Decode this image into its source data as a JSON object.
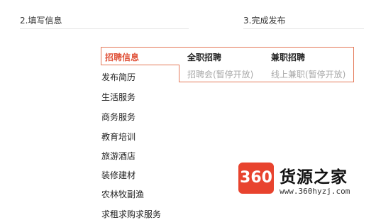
{
  "steps": {
    "step2": "2.填写信息",
    "step3": "3.完成发布"
  },
  "categories": [
    "招聘信息",
    "发布简历",
    "生活服务",
    "商务服务",
    "教育培训",
    "旅游酒店",
    "装修建材",
    "农林牧副渔",
    "求租求购求服务"
  ],
  "submenu": {
    "full_time": "全职招聘",
    "part_time": "兼职招聘",
    "job_fair": "招聘会(暂停开放)",
    "online_part_time": "线上兼职(暂停开放)"
  },
  "watermark": {
    "badge": "360",
    "name": "货源之家",
    "url": "www.360hyzj.com"
  },
  "colors": {
    "accent": "#e0533a",
    "border": "#e47a5a",
    "disabled": "#a8a8a8"
  }
}
